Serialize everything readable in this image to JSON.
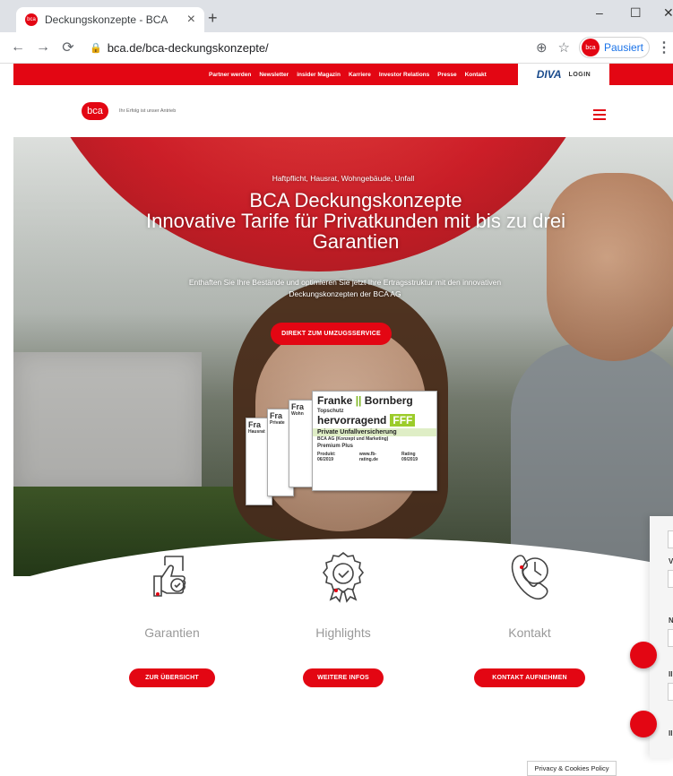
{
  "browser": {
    "tab_title": "Deckungskonzepte - BCA",
    "tab_close": "×",
    "new_tab": "+",
    "url": "bca.de/bca-deckungskonzepte/",
    "profile_status": "Pausiert",
    "profile_initials": "bca",
    "window_controls": {
      "minimize": "–",
      "maximize": "☐",
      "close": "✕"
    }
  },
  "topnav": {
    "links": [
      "Partner werden",
      "Newsletter",
      "insider Magazin",
      "Karriere",
      "Investor Relations",
      "Presse",
      "Kontakt"
    ],
    "diva_logo": "DIVA",
    "diva_login": "LOGIN"
  },
  "header": {
    "logo": "bca",
    "slogan": "Ihr Erfolg ist unser Antrieb"
  },
  "hero": {
    "kicker": "Haftpflicht, Hausrat, Wohngebäude, Unfall",
    "title_line1": "BCA Deckungskonzepte",
    "title_line2": "Innovative Tarife für Privatkunden mit bis zu drei",
    "title_line3": "Garantien",
    "lead": "Enthaften Sie Ihre Bestände und optimieren Sie jetzt Ihre Ertragsstruktur mit den innovativen Deckungskonzepten der BCA AG",
    "button": "DIREKT ZUM UMZUGSSERVICE",
    "seal": {
      "brand_a": "Franke",
      "brand_b": "Bornberg",
      "topschutz": "Topschutz",
      "rating": "hervorragend",
      "fff": "FFF",
      "product": "Private Unfallversicherung",
      "company": "BCA AG (Konzept und Marketing)",
      "tariff": "Premium Plus",
      "date": "Produkt: 06/2019",
      "site": "www.fb-rating.de",
      "rating_date": "Rating 09/2019",
      "back_texts": [
        "Fra",
        "Fra",
        "Fra"
      ],
      "back_lines": [
        "hervorragend",
        "Hausrat",
        "Private",
        "Wohn"
      ]
    }
  },
  "features": [
    {
      "label": "Garantien",
      "button": "ZUR ÜBERSICHT"
    },
    {
      "label": "Highlights",
      "button": "WEITERE INFOS"
    },
    {
      "label": "Kontakt",
      "button": "KONTAKT AUFNEHMEN"
    }
  ],
  "sidepanel": {
    "labels": [
      "V",
      "N",
      "II",
      "II"
    ]
  },
  "privacy": "Privacy & Cookies Policy",
  "colors": {
    "brand_red": "#e30613"
  }
}
